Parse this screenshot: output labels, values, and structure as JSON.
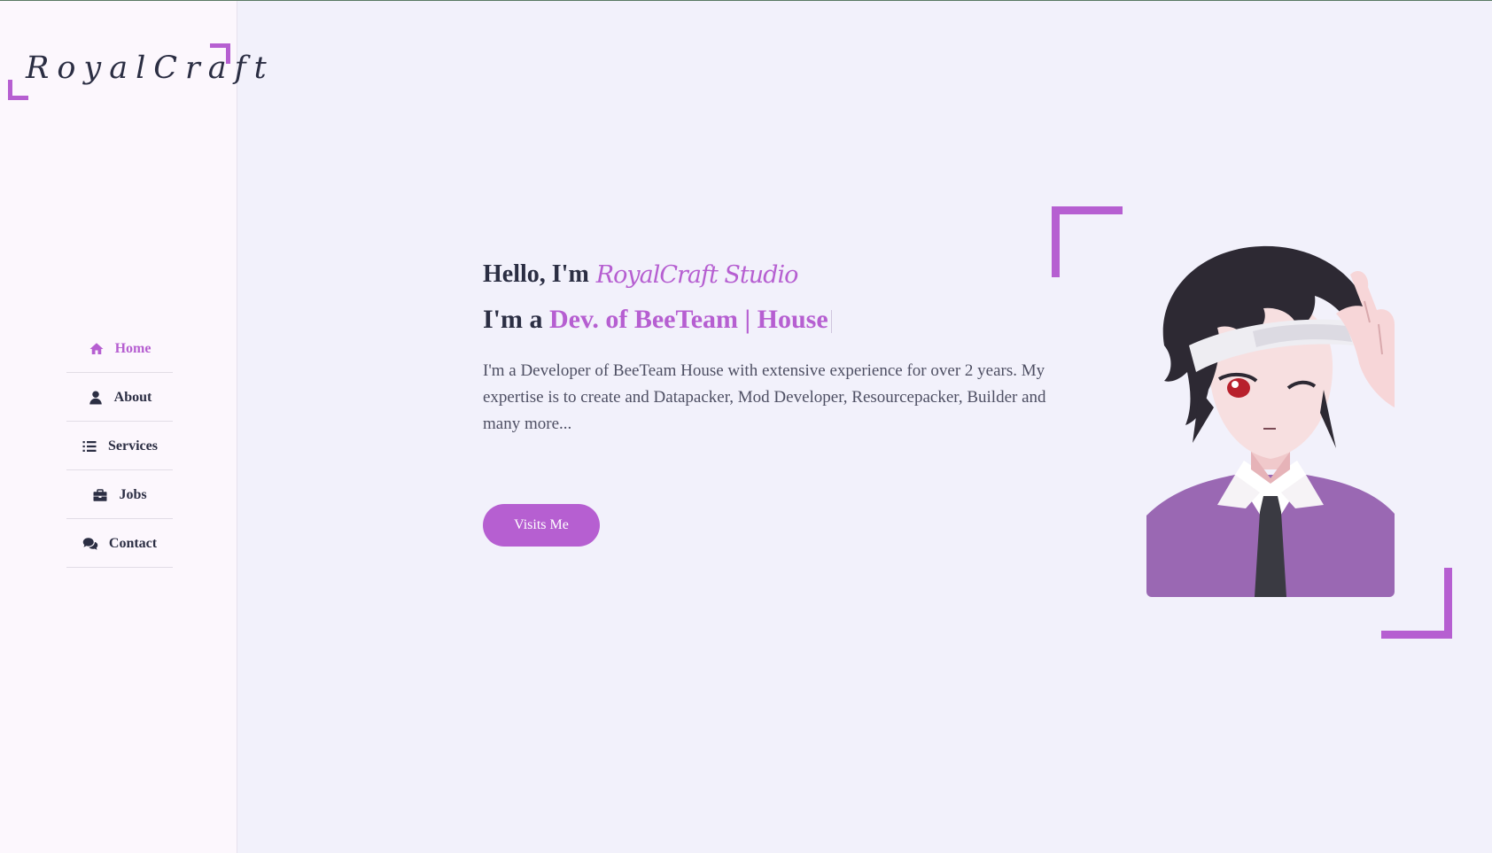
{
  "brand": {
    "logo": "RoyalCraft"
  },
  "sidebar": {
    "items": [
      {
        "label": "Home",
        "icon": "home-icon",
        "active": true
      },
      {
        "label": "About",
        "icon": "user-icon",
        "active": false
      },
      {
        "label": "Services",
        "icon": "list-icon",
        "active": false
      },
      {
        "label": "Jobs",
        "icon": "briefcase-icon",
        "active": false
      },
      {
        "label": "Contact",
        "icon": "chat-icon",
        "active": false
      }
    ]
  },
  "hero": {
    "hello_prefix": "Hello, I'm",
    "hello_name": "RoyalCraft Studio",
    "role_prefix": "I'm a",
    "role_text": "Dev. of BeeTeam | House",
    "description": "I'm a Developer of BeeTeam House with extensive experience for over 2 years. My expertise is to create and Datapacker, Mod Developer, Resourcepacker, Builder and many more...",
    "cta_label": "Visits Me"
  },
  "colors": {
    "accent": "#b65fd1",
    "text_dark": "#2b2e43",
    "background": "#f2f1fb",
    "sidebar_bg": "#fcf7fd"
  }
}
